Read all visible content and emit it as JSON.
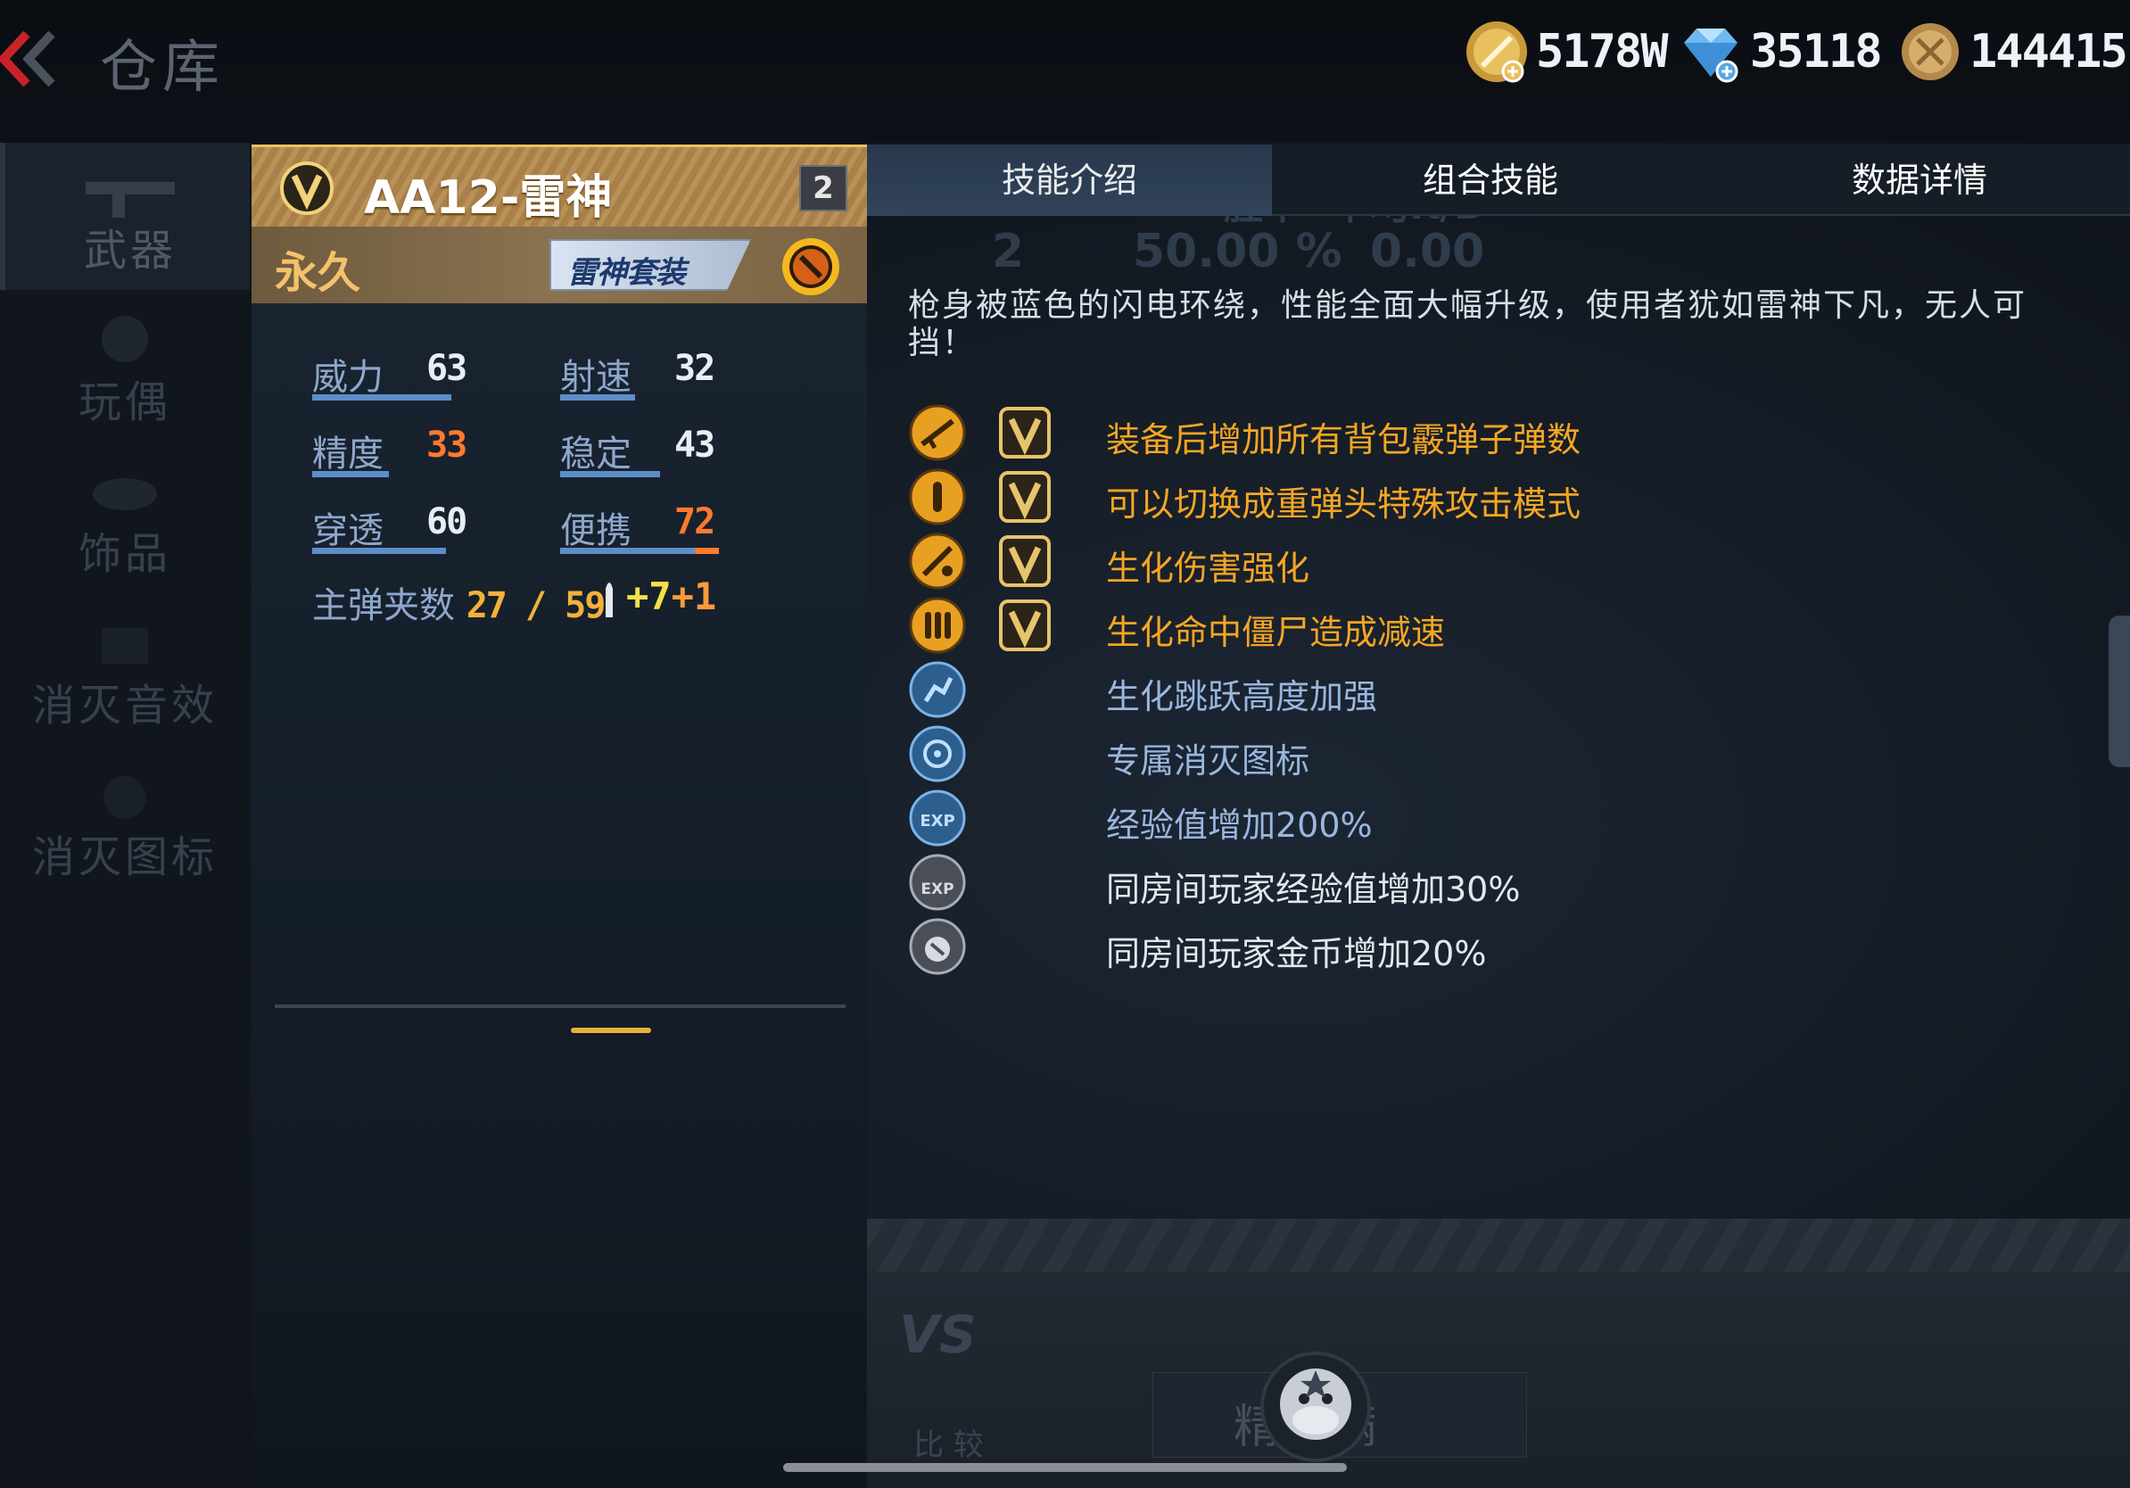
{
  "header": {
    "title": "仓库",
    "gold": "5178W",
    "diamonds": "35118",
    "medals": "144415"
  },
  "sidebar": {
    "items": [
      {
        "label": "武器"
      },
      {
        "label": "玩偶"
      },
      {
        "label": "饰品"
      },
      {
        "label": "消灭音效"
      },
      {
        "label": "消灭图标"
      }
    ]
  },
  "weapon": {
    "name": "AA12-雷神",
    "level": "2",
    "duration": "永久",
    "suit": "雷神套装",
    "stats": [
      {
        "name": "威力",
        "value": "63",
        "bar_fraction": 0.75
      },
      {
        "name": "射速",
        "value": "32",
        "bar_fraction": 0.5
      },
      {
        "name": "精度",
        "value": "33",
        "bar_fraction": 0.5
      },
      {
        "name": "稳定",
        "value": "43",
        "bar_fraction": 0.66
      },
      {
        "name": "穿透",
        "value": "60",
        "bar_fraction": 0.75
      },
      {
        "name": "便携",
        "value": "72",
        "bar_fraction": 0.9
      }
    ],
    "ammo_label": "主弹夹数",
    "ammo_value": "27 / 59",
    "bonus_yellow": "+7",
    "bonus_orange": "+1"
  },
  "tabs": [
    {
      "label": "技能介绍"
    },
    {
      "label": "组合技能"
    },
    {
      "label": "数据详情"
    }
  ],
  "ghost": {
    "a": "2",
    "b": "50.00 %",
    "c": "0.00",
    "d": "胜率",
    "e": "平均K/D"
  },
  "skills": {
    "description": "枪身被蓝色的闪电环绕，性能全面大幅升级，使用者犹如雷神下凡，无人可挡！",
    "items": [
      {
        "text": "装备后增加所有背包霰弹子弹数",
        "icon": "shotgun-icon"
      },
      {
        "text": "可以切换成重弹头特殊攻击模式",
        "icon": "bullet-icon"
      },
      {
        "text": "生化伤害强化",
        "icon": "bio-damage-icon"
      },
      {
        "text": "生化命中僵尸造成减速",
        "icon": "ammo-icon"
      },
      {
        "text": "生化跳跃高度加强",
        "icon": "jump-icon"
      },
      {
        "text": "专属消灭图标",
        "icon": "kill-icon"
      },
      {
        "text": "经验值增加200%",
        "icon": "exp-icon"
      },
      {
        "text": "同房间玩家经验值增加30%",
        "icon": "room-exp-icon"
      },
      {
        "text": "同房间玩家金币增加20%",
        "icon": "room-coin-icon"
      }
    ]
  },
  "bottom": {
    "vs": "VS",
    "compare": "比 较",
    "full": "精 满"
  },
  "colors": {
    "gold_text": "#f5a623",
    "blue_text": "#9ab6df",
    "accent": "#e7b23c"
  }
}
